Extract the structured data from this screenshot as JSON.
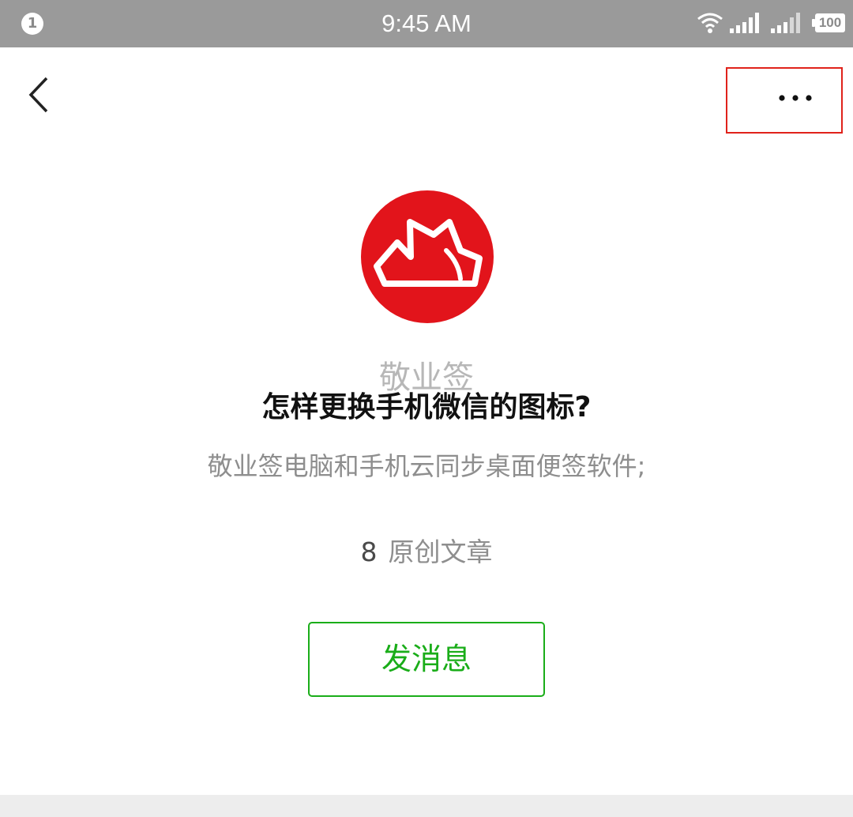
{
  "status_bar": {
    "notification_count": "1",
    "time": "9:45 AM",
    "battery": "100",
    "icons": [
      "wifi-icon",
      "signal-sim1-icon",
      "signal-sim2-icon",
      "battery-icon"
    ]
  },
  "nav": {
    "back_icon": "chevron-left-icon",
    "more_icon": "more-dots-icon",
    "highlight_color": "#e0221b"
  },
  "profile": {
    "name": "敬业签",
    "headline": "怎样更换手机微信的图标?",
    "description": "敬业签电脑和手机云同步桌面便签软件;",
    "article_count": "8",
    "article_label": "原创文章",
    "avatar_color": "#e2141b"
  },
  "actions": {
    "send_message_label": "发消息",
    "accent_color": "#1aad19"
  }
}
